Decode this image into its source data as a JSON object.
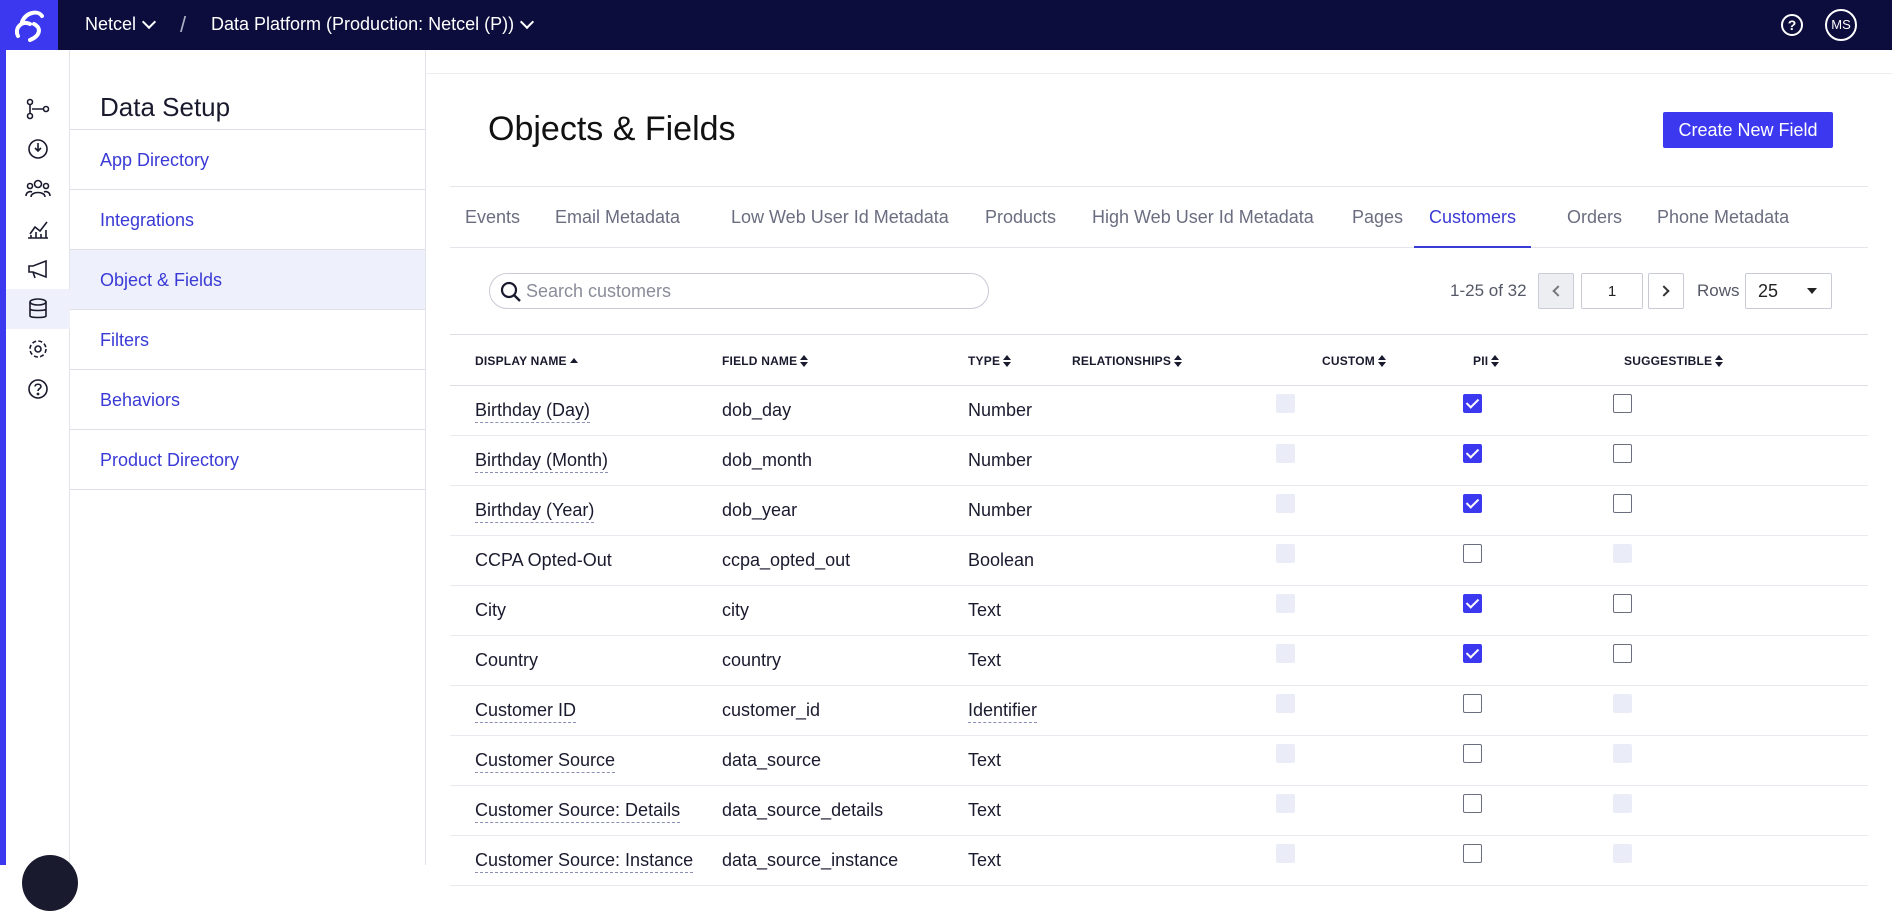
{
  "header": {
    "org": "Netcel",
    "separator": "/",
    "project": "Data Platform (Production: Netcel (P))",
    "help": "?",
    "user_initials": "MS"
  },
  "rail": [
    "workflow-icon",
    "insights-icon",
    "audience-icon",
    "analytics-icon",
    "campaigns-icon",
    "database-icon",
    "settings-icon",
    "help-icon"
  ],
  "subnav": {
    "title": "Data Setup",
    "items": [
      {
        "label": "App Directory"
      },
      {
        "label": "Integrations"
      },
      {
        "label": "Object & Fields"
      },
      {
        "label": "Filters"
      },
      {
        "label": "Behaviors"
      },
      {
        "label": "Product Directory"
      }
    ]
  },
  "main": {
    "title": "Objects & Fields",
    "create_label": "Create New Field",
    "tabs": [
      {
        "label": "Events"
      },
      {
        "label": "Email Metadata"
      },
      {
        "label": "Low Web User Id Metadata"
      },
      {
        "label": "Products"
      },
      {
        "label": "High Web User Id Metadata"
      },
      {
        "label": "Pages"
      },
      {
        "label": "Customers"
      },
      {
        "label": "Orders"
      },
      {
        "label": "Phone Metadata"
      }
    ],
    "search_placeholder": "Search customers",
    "pager": {
      "range": "1-25 of 32",
      "page": "1",
      "rows_label": "Rows",
      "rows_value": "25"
    },
    "columns": [
      "DISPLAY NAME",
      "FIELD NAME",
      "TYPE",
      "RELATIONSHIPS",
      "CUSTOM",
      "PII",
      "SUGGESTIBLE"
    ],
    "rows": [
      {
        "display": "Birthday (Day)",
        "field": "dob_day",
        "type": "Number",
        "pii": true,
        "suggestible": false
      },
      {
        "display": "Birthday (Month)",
        "field": "dob_month",
        "type": "Number",
        "pii": true,
        "suggestible": false
      },
      {
        "display": "Birthday (Year)",
        "field": "dob_year",
        "type": "Number",
        "pii": true,
        "suggestible": false
      },
      {
        "display": "CCPA Opted-Out",
        "field": "ccpa_opted_out",
        "type": "Boolean",
        "pii": false,
        "suggestible": null
      },
      {
        "display": "City",
        "field": "city",
        "type": "Text",
        "pii": true,
        "suggestible": false
      },
      {
        "display": "Country",
        "field": "country",
        "type": "Text",
        "pii": true,
        "suggestible": false
      },
      {
        "display": "Customer ID",
        "field": "customer_id",
        "type": "Identifier",
        "pii": false,
        "suggestible": null
      },
      {
        "display": "Customer Source",
        "field": "data_source",
        "type": "Text",
        "pii": false,
        "suggestible": null
      },
      {
        "display": "Customer Source: Details",
        "field": "data_source_details",
        "type": "Text",
        "pii": false,
        "suggestible": null
      },
      {
        "display": "Customer Source: Instance",
        "field": "data_source_instance",
        "type": "Text",
        "pii": false,
        "suggestible": null
      }
    ]
  }
}
